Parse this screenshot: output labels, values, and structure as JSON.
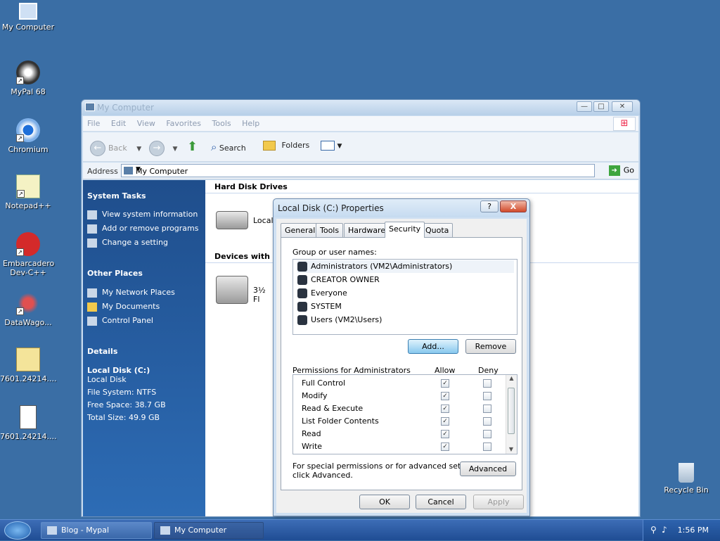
{
  "desktop": {
    "icons": [
      {
        "label": "My Computer"
      },
      {
        "label": "MyPal 68"
      },
      {
        "label": "Chromium"
      },
      {
        "label": "Notepad++"
      },
      {
        "label": "Embarcadero Dev-C++"
      },
      {
        "label": "DataWago..."
      },
      {
        "label": "7601.24214...."
      },
      {
        "label": "7601.24214...."
      },
      {
        "label": "Recycle Bin"
      }
    ]
  },
  "explorer": {
    "title": "My Computer",
    "menu": [
      "File",
      "Edit",
      "View",
      "Favorites",
      "Tools",
      "Help"
    ],
    "toolbar": {
      "back": "Back",
      "search": "Search",
      "folders": "Folders"
    },
    "address": {
      "label": "Address",
      "value": "My Computer",
      "go": "Go"
    },
    "side": {
      "system_tasks": {
        "title": "System Tasks",
        "items": [
          "View system information",
          "Add or remove programs",
          "Change a setting"
        ]
      },
      "other_places": {
        "title": "Other Places",
        "items": [
          "My Network Places",
          "My Documents",
          "Control Panel"
        ]
      },
      "details": {
        "title": "Details",
        "name": "Local Disk (C:)",
        "type": "Local Disk",
        "fs": "File System: NTFS",
        "free": "Free Space: 38.7 GB",
        "total": "Total Size: 49.9 GB"
      }
    },
    "main": {
      "group1": "Hard Disk Drives",
      "drive1": "Local",
      "group2": "Devices with Rem",
      "drive2": "3½ Fl"
    }
  },
  "dialog": {
    "title": "Local Disk (C:) Properties",
    "help": "?",
    "close": "X",
    "tabs": [
      "General",
      "Tools",
      "Hardware",
      "Security",
      "Quota"
    ],
    "active_tab": "Security",
    "group_label": "Group or user names:",
    "users": [
      "Administrators (VM2\\Administrators)",
      "CREATOR OWNER",
      "Everyone",
      "SYSTEM",
      "Users (VM2\\Users)"
    ],
    "add": "Add...",
    "remove": "Remove",
    "perm_label": "Permissions for Administrators",
    "allow": "Allow",
    "deny": "Deny",
    "permissions": [
      {
        "name": "Full Control",
        "allow": true,
        "deny": false
      },
      {
        "name": "Modify",
        "allow": true,
        "deny": false
      },
      {
        "name": "Read & Execute",
        "allow": true,
        "deny": false
      },
      {
        "name": "List Folder Contents",
        "allow": true,
        "deny": false
      },
      {
        "name": "Read",
        "allow": true,
        "deny": false
      },
      {
        "name": "Write",
        "allow": true,
        "deny": false
      }
    ],
    "special_text_1": "For special permissions or for advanced settings,",
    "special_text_2": "click Advanced.",
    "advanced": "Advanced",
    "ok": "OK",
    "cancel": "Cancel",
    "apply": "Apply"
  },
  "taskbar": {
    "items": [
      "Blog - Mypal",
      "My Computer"
    ],
    "clock": "1:56 PM"
  }
}
